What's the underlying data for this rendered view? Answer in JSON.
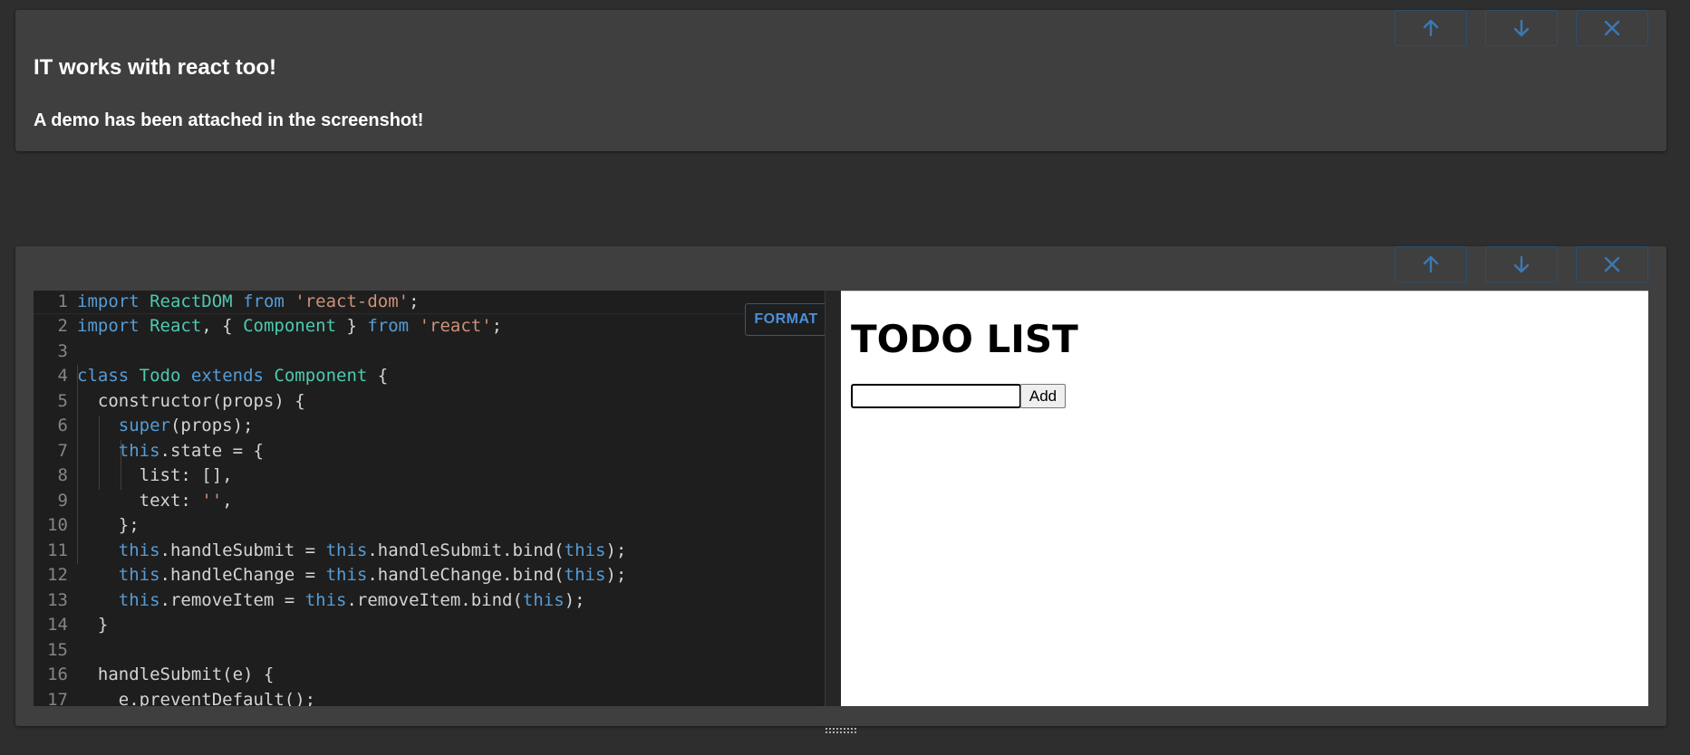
{
  "card1": {
    "heading": "IT works with react too!",
    "paragraph": "A demo has been attached in the screenshot!"
  },
  "controls": {
    "up_icon": "arrow-up-icon",
    "down_icon": "arrow-down-icon",
    "close_icon": "close-icon"
  },
  "editor": {
    "format_label": "FORMAT",
    "lines": [
      {
        "n": "1",
        "tokens": [
          [
            "kw",
            "import"
          ],
          [
            "pl",
            " "
          ],
          [
            "cls",
            "ReactDOM"
          ],
          [
            "pl",
            " "
          ],
          [
            "kw",
            "from"
          ],
          [
            "pl",
            " "
          ],
          [
            "str",
            "'react-dom'"
          ],
          [
            "pl",
            ";"
          ]
        ]
      },
      {
        "n": "2",
        "tokens": [
          [
            "kw",
            "import"
          ],
          [
            "pl",
            " "
          ],
          [
            "cls",
            "React"
          ],
          [
            "pl",
            ", { "
          ],
          [
            "cls",
            "Component"
          ],
          [
            "pl",
            " } "
          ],
          [
            "kw",
            "from"
          ],
          [
            "pl",
            " "
          ],
          [
            "str",
            "'react'"
          ],
          [
            "pl",
            ";"
          ]
        ]
      },
      {
        "n": "3",
        "tokens": []
      },
      {
        "n": "4",
        "tokens": [
          [
            "kw",
            "class"
          ],
          [
            "pl",
            " "
          ],
          [
            "cls",
            "Todo"
          ],
          [
            "pl",
            " "
          ],
          [
            "kw",
            "extends"
          ],
          [
            "pl",
            " "
          ],
          [
            "cls",
            "Component"
          ],
          [
            "pl",
            " {"
          ]
        ]
      },
      {
        "n": "5",
        "tokens": [
          [
            "pl",
            "  "
          ],
          [
            "pl",
            "constructor"
          ],
          [
            "pl",
            "(props) {"
          ]
        ]
      },
      {
        "n": "6",
        "tokens": [
          [
            "pl",
            "    "
          ],
          [
            "kw",
            "super"
          ],
          [
            "pl",
            "(props);"
          ]
        ]
      },
      {
        "n": "7",
        "tokens": [
          [
            "pl",
            "    "
          ],
          [
            "kw",
            "this"
          ],
          [
            "pl",
            ".state = {"
          ]
        ]
      },
      {
        "n": "8",
        "tokens": [
          [
            "pl",
            "      list: [],"
          ]
        ]
      },
      {
        "n": "9",
        "tokens": [
          [
            "pl",
            "      text: "
          ],
          [
            "str",
            "''"
          ],
          [
            "pl",
            ","
          ]
        ]
      },
      {
        "n": "10",
        "tokens": [
          [
            "pl",
            "    };"
          ]
        ]
      },
      {
        "n": "11",
        "tokens": [
          [
            "pl",
            "    "
          ],
          [
            "kw",
            "this"
          ],
          [
            "pl",
            ".handleSubmit = "
          ],
          [
            "kw",
            "this"
          ],
          [
            "pl",
            ".handleSubmit.bind("
          ],
          [
            "kw",
            "this"
          ],
          [
            "pl",
            ");"
          ]
        ]
      },
      {
        "n": "12",
        "tokens": [
          [
            "pl",
            "    "
          ],
          [
            "kw",
            "this"
          ],
          [
            "pl",
            ".handleChange = "
          ],
          [
            "kw",
            "this"
          ],
          [
            "pl",
            ".handleChange.bind("
          ],
          [
            "kw",
            "this"
          ],
          [
            "pl",
            ");"
          ]
        ]
      },
      {
        "n": "13",
        "tokens": [
          [
            "pl",
            "    "
          ],
          [
            "kw",
            "this"
          ],
          [
            "pl",
            ".removeItem = "
          ],
          [
            "kw",
            "this"
          ],
          [
            "pl",
            ".removeItem.bind("
          ],
          [
            "kw",
            "this"
          ],
          [
            "pl",
            ");"
          ]
        ]
      },
      {
        "n": "14",
        "tokens": [
          [
            "pl",
            "  }"
          ]
        ]
      },
      {
        "n": "15",
        "tokens": []
      },
      {
        "n": "16",
        "tokens": [
          [
            "pl",
            "  handleSubmit(e) {"
          ]
        ]
      },
      {
        "n": "17",
        "tokens": [
          [
            "pl",
            "    e.preventDefault();"
          ]
        ]
      }
    ]
  },
  "preview": {
    "title": "TODO LIST",
    "input_value": "",
    "add_label": "Add"
  }
}
